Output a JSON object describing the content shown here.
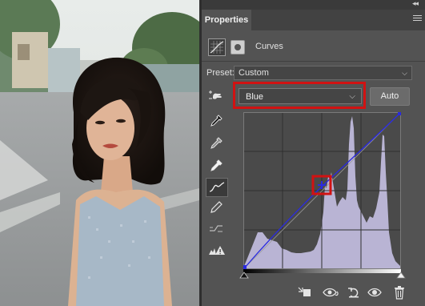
{
  "window": {
    "collapse_glyph": "◂◂",
    "close_glyph": "✕"
  },
  "panel": {
    "tab_label": "Properties",
    "menu_icon": "hamburger-icon",
    "adjustment": {
      "icon": "curves-adjustment-icon",
      "mask_icon": "layer-mask-icon",
      "title": "Curves"
    },
    "preset": {
      "label": "Preset:",
      "value": "Custom"
    },
    "channel": {
      "value": "Blue"
    },
    "auto_label": "Auto",
    "tools": [
      {
        "name": "on-image-adjust-tool",
        "icon": "hand-arrows-icon"
      },
      {
        "name": "black-point-eyedropper",
        "icon": "eyedropper-black-icon"
      },
      {
        "name": "gray-point-eyedropper",
        "icon": "eyedropper-gray-icon"
      },
      {
        "name": "white-point-eyedropper",
        "icon": "eyedropper-white-icon"
      },
      {
        "name": "edit-points-tool",
        "icon": "curve-points-icon"
      },
      {
        "name": "draw-curve-tool",
        "icon": "pencil-icon"
      },
      {
        "name": "smooth-curve-tool",
        "icon": "smooth-icon"
      },
      {
        "name": "clipping-warning-tool",
        "icon": "clipping-warning-icon"
      }
    ],
    "curve": {
      "channel_color": "#2a2ae0",
      "histogram_color": "#b9b4d4",
      "point_highlight_color": "#d11212",
      "control_point_value": {
        "input": 122,
        "output": 136
      }
    },
    "bottom_actions": [
      {
        "name": "clip-to-layer-button",
        "icon": "clip-icon"
      },
      {
        "name": "view-previous-button",
        "icon": "eye-previous-icon"
      },
      {
        "name": "reset-button",
        "icon": "reset-icon"
      },
      {
        "name": "toggle-visibility-button",
        "icon": "eye-icon"
      },
      {
        "name": "delete-button",
        "icon": "trash-icon"
      }
    ]
  },
  "photo": {
    "subject": "portrait-photo"
  }
}
